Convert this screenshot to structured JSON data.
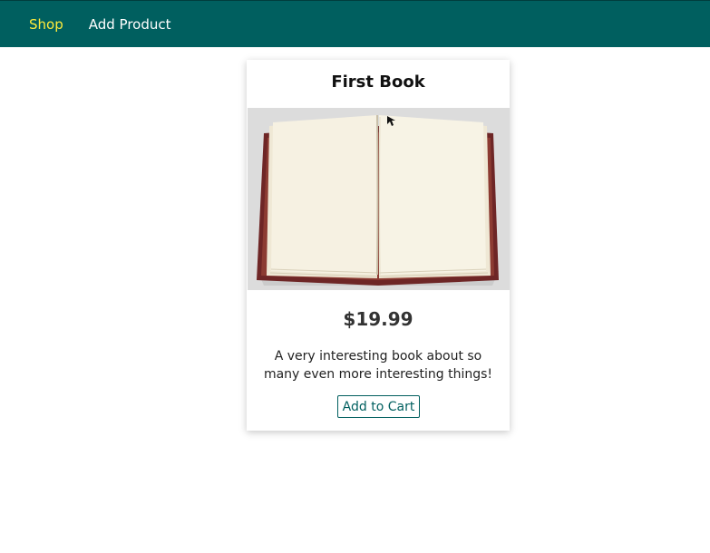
{
  "nav": {
    "items": [
      {
        "label": "Shop",
        "active": true
      },
      {
        "label": "Add Product",
        "active": false
      }
    ]
  },
  "product": {
    "title": "First Book",
    "price": "$19.99",
    "description": "A very interesting book about so many even more interesting things!",
    "add_to_cart_label": "Add to Cart",
    "image_icon": "open-book-image"
  },
  "colors": {
    "header_bg": "#005f5f",
    "active_nav": "#ffeb3b",
    "accent": "#005f5f"
  }
}
